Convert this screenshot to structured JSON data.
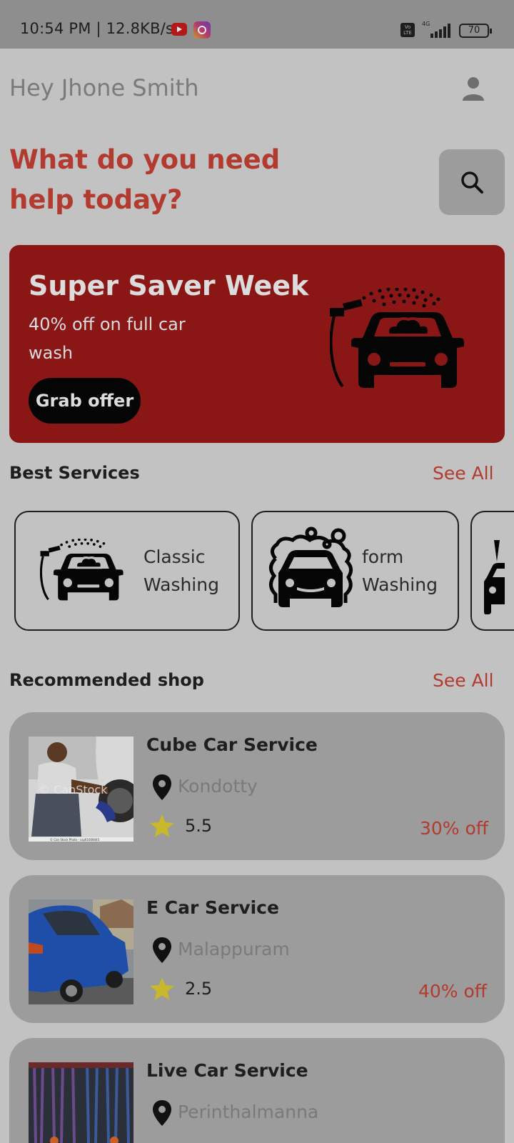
{
  "status_bar": {
    "time_text": "10:54 PM | 12.8KB/s",
    "volte": "Vo LTE",
    "network": "4G",
    "battery": "70"
  },
  "header": {
    "greeting": "Hey Jhone Smith",
    "headline_line1": "What do you need",
    "headline_line2": "help today?"
  },
  "banner": {
    "title": "Super Saver Week",
    "subtitle": "40% off on full car wash",
    "button": "Grab offer",
    "background": "#8a1616"
  },
  "best_services": {
    "title": "Best Services",
    "see_all": "See All",
    "items": [
      {
        "line1": "Classic",
        "line2": "Washing",
        "icon": "car-wash-spray-icon"
      },
      {
        "line1": "form",
        "line2": "Washing",
        "icon": "car-foam-icon"
      }
    ]
  },
  "recommended": {
    "title": "Recommended shop",
    "see_all": "See All",
    "shops": [
      {
        "name": "Cube Car Service",
        "location": "Kondotty",
        "rating": "5.5",
        "offer": "30% off",
        "image": "mechanic-photo",
        "watermark": "© CanStock",
        "caption": "© Can Stock Photo - csp61608445"
      },
      {
        "name": "E Car Service",
        "location": "Malappuram",
        "rating": "2.5",
        "offer": "40% off",
        "image": "blue-car-wash-photo"
      },
      {
        "name": "Live Car Service",
        "location": "Perinthalmanna",
        "image": "car-wash-brushes-photo"
      }
    ]
  },
  "colors": {
    "accent": "#b23a2e",
    "card": "#9c9c9c",
    "background": "#c2c2c2",
    "star": "#c9b82a"
  }
}
